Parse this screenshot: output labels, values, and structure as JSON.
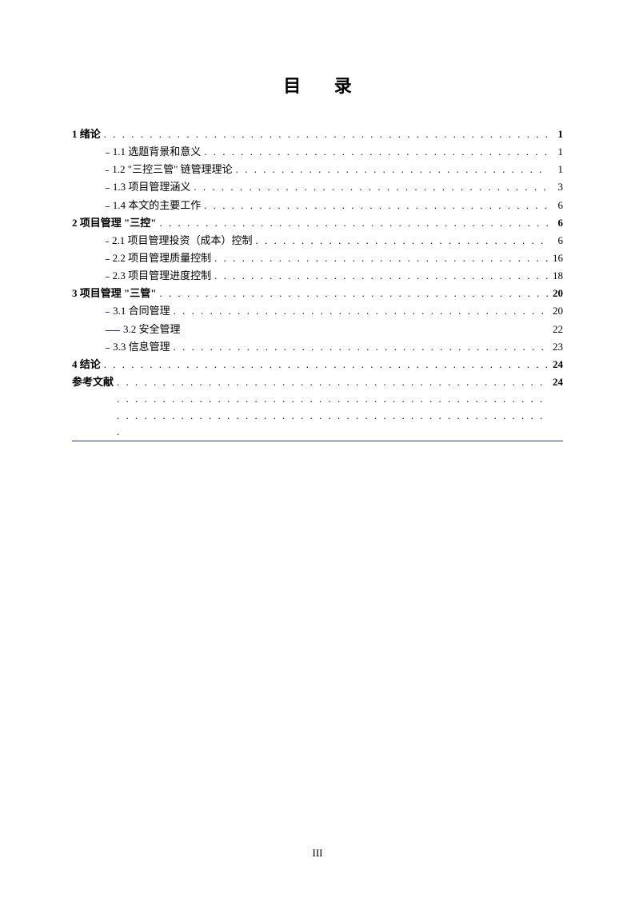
{
  "title": "目 录",
  "footer": "III",
  "toc": [
    {
      "level": 1,
      "label": "1 绪论",
      "page": "1",
      "link": false,
      "leader": true
    },
    {
      "level": 2,
      "label": "1.1 选题背景和意义",
      "page": "1",
      "link": true,
      "leader": true
    },
    {
      "level": 2,
      "label": "1.2 \"三控三管\" 链管理理论",
      "page": "1",
      "link": true,
      "leader": true
    },
    {
      "level": 2,
      "label": "1.3 项目管理涵义",
      "page": "3",
      "link": true,
      "leader": true
    },
    {
      "level": 2,
      "label": "1.4 本文的主要工作",
      "page": "6",
      "link": true,
      "leader": true
    },
    {
      "level": 1,
      "label": "2 项目管理 \"三控\"",
      "page": "6",
      "link": false,
      "leader": true
    },
    {
      "level": 2,
      "label": "2.1 项目管理投资（成本）控制",
      "page": "6",
      "link": true,
      "leader": true
    },
    {
      "level": 2,
      "label": "2.2 项目管理质量控制",
      "page": "16",
      "link": true,
      "leader": true
    },
    {
      "level": 2,
      "label": "2.3 项目管理进度控制",
      "page": "18",
      "link": true,
      "leader": true
    },
    {
      "level": 1,
      "label": "3 项目管理 \"三管\"",
      "page": "20",
      "link": false,
      "leader": true
    },
    {
      "level": 2,
      "label": "3.1 合同管理",
      "page": "20",
      "link": true,
      "leader": true
    },
    {
      "level": 2,
      "label": "3.2 安全管理",
      "page": "22",
      "link": true,
      "leader": false
    },
    {
      "level": 2,
      "label": "3.3 信息管理",
      "page": "23",
      "link": true,
      "leader": true
    },
    {
      "level": 1,
      "label": "4 结论",
      "page": "24",
      "link": false,
      "leader": true
    }
  ],
  "references": {
    "label": "参考文献",
    "page": "24"
  }
}
